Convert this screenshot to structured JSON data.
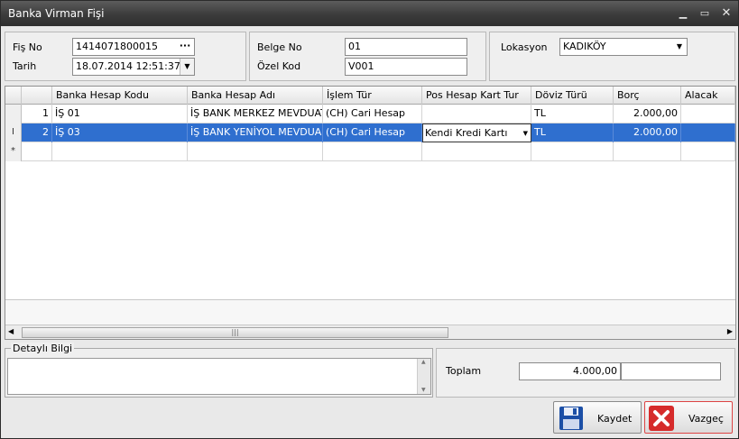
{
  "window": {
    "title": "Banka Virman Fişi"
  },
  "header": {
    "fis_no_label": "Fiş No",
    "fis_no": "1414071800015",
    "dots": "···",
    "tarih_label": "Tarih",
    "tarih": "18.07.2014 12:51:37",
    "belge_no_label": "Belge No",
    "belge_no": "01",
    "ozel_kod_label": "Özel Kod",
    "ozel_kod": "V001",
    "lokasyon_label": "Lokasyon",
    "lokasyon": "KADIKÖY"
  },
  "grid": {
    "columns": [
      "Banka Hesap Kodu",
      "Banka Hesap Adı",
      "İşlem Tür",
      "Pos Hesap Kart Tur",
      "Döviz Türü",
      "Borç",
      "Alacak"
    ],
    "rows": [
      {
        "no": "1",
        "kod": "İŞ 01",
        "ad": "İŞ BANK MERKEZ MEVDUAT...",
        "islem": "(CH) Cari Hesap",
        "pos": "",
        "doviz": "TL",
        "borc": "2.000,00",
        "alacak": ""
      },
      {
        "no": "2",
        "kod": "İŞ 03",
        "ad": "İŞ BANK YENİYOL MEVDUA...",
        "islem": "(CH) Cari Hesap",
        "pos": "Kendi Kredi Kartı",
        "doviz": "TL",
        "borc": "2.000,00",
        "alacak": ""
      }
    ],
    "new_row_marker": "*",
    "edit_marker": "I"
  },
  "detail": {
    "label": "Detaylı Bilgi",
    "text": ""
  },
  "totals": {
    "label": "Toplam",
    "borc": "4.000,00",
    "alacak": ""
  },
  "buttons": {
    "save": "Kaydet",
    "cancel": "Vazgeç"
  }
}
